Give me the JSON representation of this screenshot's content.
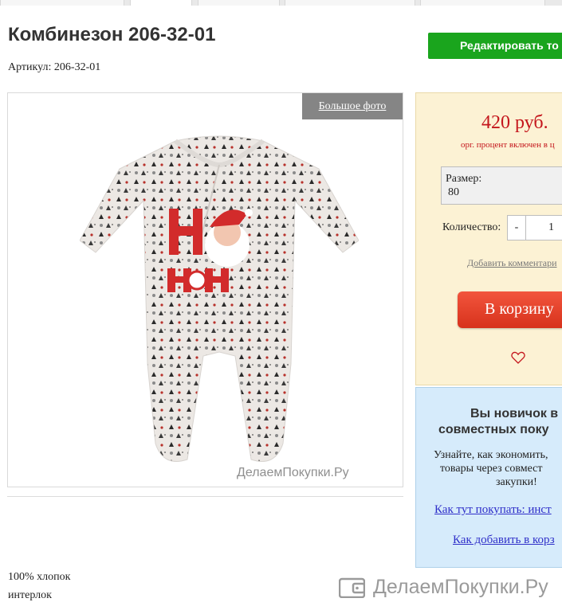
{
  "product": {
    "title": "Комбинезон 206-32-01",
    "sku": "Артикул: 206-32-01",
    "edit_label": "Редактировать то",
    "big_photo_label": "Большое фото",
    "photo_watermark": "ДелаемПокупки.Ру",
    "description": [
      "100% хлопок",
      "интерлок"
    ]
  },
  "buy": {
    "price": "420 руб.",
    "price_note": "орг. процент включен в ц",
    "size_label": "Размер:",
    "size_value": "80",
    "quantity_label": "Количество:",
    "minus_label": "-",
    "quantity_value": "1",
    "add_comment_label": "Добавить комментари",
    "cart_label": "В корзину",
    "heart_icon": "heart-outline-icon",
    "accent": "#c4161c"
  },
  "info": {
    "title_line1": "Вы новичок в",
    "title_line2": "совместных поку",
    "text_line1": "Узнайте, как экономить,",
    "text_line2": "товары через совмест",
    "text_line3": "закупки!",
    "link1": "Как тут покупать: инст",
    "link2": "Как добавить в корз"
  },
  "footer": {
    "logo_text": "ДелаемПокупки.Ру",
    "logo_icon": "wallet-icon"
  }
}
